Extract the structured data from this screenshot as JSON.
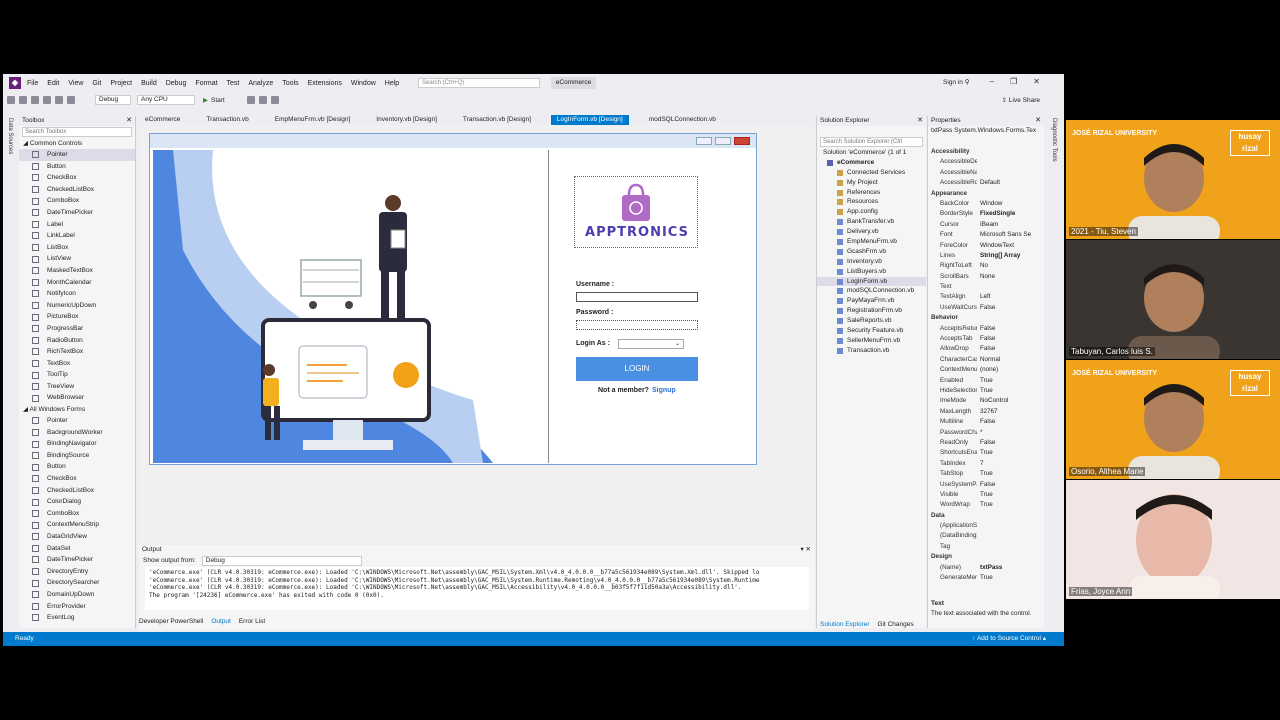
{
  "ide": {
    "menu": [
      "File",
      "Edit",
      "View",
      "Git",
      "Project",
      "Build",
      "Debug",
      "Format",
      "Test",
      "Analyze",
      "Tools",
      "Extensions",
      "Window",
      "Help"
    ],
    "search_placeholder": "Search (Ctrl+Q)",
    "project_name": "eCommerce",
    "sign_in": "Sign in",
    "live_share": "Live Share",
    "config": "Debug",
    "platform": "Any CPU",
    "start": "Start"
  },
  "side_labels": {
    "data_sources": "Data Sources",
    "diagnostic_tools": "Diagnostic Tools"
  },
  "toolbox": {
    "title": "Toolbox",
    "search": "Search Toolbox",
    "common_header": "Common Controls",
    "common": [
      "Pointer",
      "Button",
      "CheckBox",
      "CheckedListBox",
      "ComboBox",
      "DateTimePicker",
      "Label",
      "LinkLabel",
      "ListBox",
      "ListView",
      "MaskedTextBox",
      "MonthCalendar",
      "NotifyIcon",
      "NumericUpDown",
      "PictureBox",
      "ProgressBar",
      "RadioButton",
      "RichTextBox",
      "TextBox",
      "ToolTip",
      "TreeView",
      "WebBrowser"
    ],
    "all_header": "All Windows Forms",
    "all": [
      "Pointer",
      "BackgroundWorker",
      "BindingNavigator",
      "BindingSource",
      "Button",
      "CheckBox",
      "CheckedListBox",
      "ColorDialog",
      "ComboBox",
      "ContextMenuStrip",
      "DataGridView",
      "DataSet",
      "DateTimePicker",
      "DirectoryEntry",
      "DirectorySearcher",
      "DomainUpDown",
      "ErrorProvider",
      "EventLog"
    ]
  },
  "doc_tabs": [
    "eCommerce",
    "Transaction.vb",
    "EmpMenuFrm.vb [Design]",
    "Inventory.vb [Design]",
    "Transaction.vb [Design]",
    "LogInForm.vb [Design]",
    "modSQLConnection.vb"
  ],
  "form": {
    "brand": "APPTRONICS",
    "username_label": "Username :",
    "password_label": "Password :",
    "login_as_label": "Login As :",
    "login_button": "LOGIN",
    "not_member": "Not a member?",
    "signup": "Signup"
  },
  "output": {
    "title": "Output",
    "show_from_label": "Show output from:",
    "show_from_value": "Debug",
    "lines": [
      "'eCommerce.exe' (CLR v4.0.30319: eCommerce.exe): Loaded 'C:\\WINDOWS\\Microsoft.Net\\assembly\\GAC_MSIL\\System.Xml\\v4.0_4.0.0.0__b77a5c561934e089\\System.Xml.dll'. Skipped lo",
      "'eCommerce.exe' (CLR v4.0.30319: eCommerce.exe): Loaded 'C:\\WINDOWS\\Microsoft.Net\\assembly\\GAC_MSIL\\System.Runtime.Remoting\\v4.0_4.0.0.0__b77a5c561934e089\\System.Runtime",
      "'eCommerce.exe' (CLR v4.0.30319: eCommerce.exe): Loaded 'C:\\WINDOWS\\Microsoft.Net\\assembly\\GAC_MSIL\\Accessibility\\v4.0_4.0.0.0__b03f5f7f11d50a3a\\Accessibility.dll'.",
      "The program '[24236] eCommerce.exe' has exited with code 0 (0x0)."
    ],
    "tabs": [
      "Developer PowerShell",
      "Output",
      "Error List"
    ]
  },
  "solution_explorer": {
    "title": "Solution Explorer",
    "search": "Search Solution Explorer (Ctrl",
    "solution": "Solution 'eCommerce' (1 of 1",
    "project": "eCommerce",
    "items": [
      "Connected Services",
      "My Project",
      "References",
      "Resources",
      "App.config",
      "BankTransfer.vb",
      "Delivery.vb",
      "EmpMenuFrm.vb",
      "GcashFrm.vb",
      "Inventory.vb",
      "ListBuyers.vb",
      "LogInForm.vb",
      "modSQLConnection.vb",
      "PayMayaFrm.vb",
      "RegistrationFrm.vb",
      "SaleReports.vb",
      "Security Feature.vb",
      "SellerMenuFrm.vb",
      "Transaction.vb"
    ],
    "tabs": [
      "Solution Explorer",
      "Git Changes"
    ]
  },
  "properties": {
    "title": "Properties",
    "object": "txtPass  System.Windows.Forms.Tex",
    "rows": [
      {
        "n": "Accessibility",
        "cat": true
      },
      {
        "n": "AccessibleDesc",
        "v": ""
      },
      {
        "n": "AccessibleNam",
        "v": ""
      },
      {
        "n": "AccessibleRole",
        "v": "Default"
      },
      {
        "n": "Appearance",
        "cat": true
      },
      {
        "n": "BackColor",
        "v": "Window"
      },
      {
        "n": "BorderStyle",
        "v": "FixedSingle",
        "b": true
      },
      {
        "n": "Cursor",
        "v": "IBeam"
      },
      {
        "n": "Font",
        "v": "Microsoft Sans Se"
      },
      {
        "n": "ForeColor",
        "v": "WindowText"
      },
      {
        "n": "Lines",
        "v": "String[] Array",
        "b": true
      },
      {
        "n": "RightToLeft",
        "v": "No"
      },
      {
        "n": "ScrollBars",
        "v": "None"
      },
      {
        "n": "Text",
        "v": ""
      },
      {
        "n": "TextAlign",
        "v": "Left"
      },
      {
        "n": "UseWaitCursor",
        "v": "False"
      },
      {
        "n": "Behavior",
        "cat": true
      },
      {
        "n": "AcceptsReturn",
        "v": "False"
      },
      {
        "n": "AcceptsTab",
        "v": "False"
      },
      {
        "n": "AllowDrop",
        "v": "False"
      },
      {
        "n": "CharacterCasin",
        "v": "Normal"
      },
      {
        "n": "ContextMenuSt",
        "v": "(none)"
      },
      {
        "n": "Enabled",
        "v": "True"
      },
      {
        "n": "HideSelection",
        "v": "True"
      },
      {
        "n": "ImeMode",
        "v": "NoControl"
      },
      {
        "n": "MaxLength",
        "v": "32767"
      },
      {
        "n": "Multiline",
        "v": "False"
      },
      {
        "n": "PasswordChar",
        "v": "*"
      },
      {
        "n": "ReadOnly",
        "v": "False"
      },
      {
        "n": "ShortcutsEnable",
        "v": "True"
      },
      {
        "n": "TabIndex",
        "v": "7"
      },
      {
        "n": "TabStop",
        "v": "True"
      },
      {
        "n": "UseSystemPassw",
        "v": "False"
      },
      {
        "n": "Visible",
        "v": "True"
      },
      {
        "n": "WordWrap",
        "v": "True"
      },
      {
        "n": "Data",
        "cat": true
      },
      {
        "n": "(ApplicationSet",
        "v": ""
      },
      {
        "n": "(DataBindings)",
        "v": ""
      },
      {
        "n": "Tag",
        "v": ""
      },
      {
        "n": "Design",
        "cat": true
      },
      {
        "n": "(Name)",
        "v": "txtPass",
        "b": true
      },
      {
        "n": "GenerateMemb",
        "v": "True"
      }
    ],
    "desc_title": "Text",
    "desc_body": "The text associated with the control."
  },
  "status": {
    "left": "Ready",
    "right": "Add to Source Control"
  },
  "participants": [
    {
      "name": "2021 - Tiu, Steven",
      "bg": "#f0a21a",
      "badge": "husay rizal"
    },
    {
      "name": "Tabuyan, Carlos luis S.",
      "bg": "#3a3531"
    },
    {
      "name": "Osorio, Althea Marie",
      "bg": "#f0a21a",
      "badge": "husay rizal"
    },
    {
      "name": "Frias, Joyce Ann",
      "bg": "#f2e6e4"
    }
  ],
  "jru": "JOSÉ RIZAL UNIVERSITY"
}
